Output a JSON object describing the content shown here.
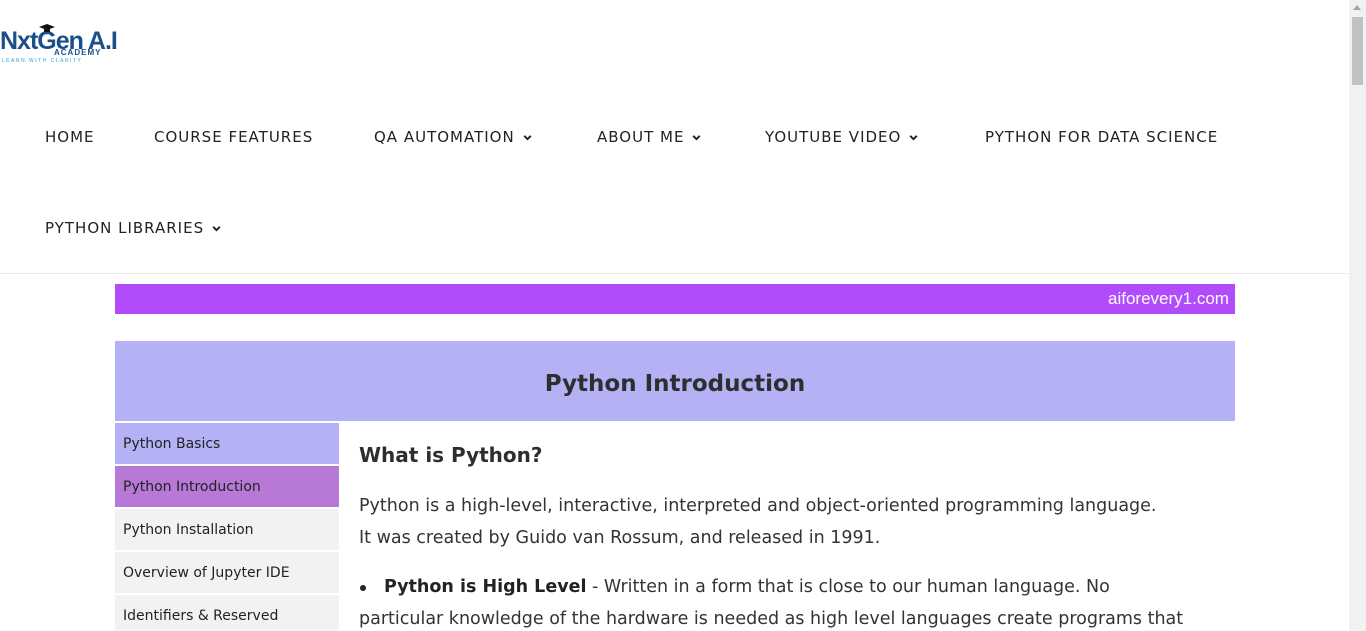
{
  "logo": {
    "main": "NxtGen A.I",
    "sub": "ACADEMY",
    "tagline": "LEARN WITH CLARITY"
  },
  "nav": {
    "home": "HOME",
    "course_features": "COURSE FEATURES",
    "qa_automation": "QA AUTOMATION",
    "about_me": "ABOUT ME",
    "youtube_video": "YOUTUBE VIDEO",
    "python_data_science": "PYTHON FOR DATA SCIENCE",
    "python_libraries": "PYTHON LIBRARIES"
  },
  "marquee": {
    "text": "aiforevery1.com"
  },
  "banner": {
    "title": "Python Introduction"
  },
  "sidebar": {
    "items": [
      {
        "label": "Python Basics"
      },
      {
        "label": "Python Introduction"
      },
      {
        "label": "Python Installation"
      },
      {
        "label": "Overview of Jupyter IDE"
      },
      {
        "label": "Identifiers & Reserved"
      }
    ]
  },
  "content": {
    "heading": "What is Python?",
    "para_line1": "Python is a high-level, interactive, interpreted and object-oriented programming language.",
    "para_line2": "It was created by Guido van Rossum, and released in 1991.",
    "bullet1_title": "Python is High Level",
    "bullet1_text": " - Written in a form that is close to our human language. No",
    "bullet1_cont": "particular knowledge of the hardware is needed as high level languages create programs that"
  },
  "colors": {
    "marquee_bg": "#b14bfb",
    "banner_bg": "#b4b2f5",
    "sidebar_active": "#b878d6",
    "sidebar_default": "#f1f2f4",
    "logo_blue": "#1b4f8a"
  }
}
